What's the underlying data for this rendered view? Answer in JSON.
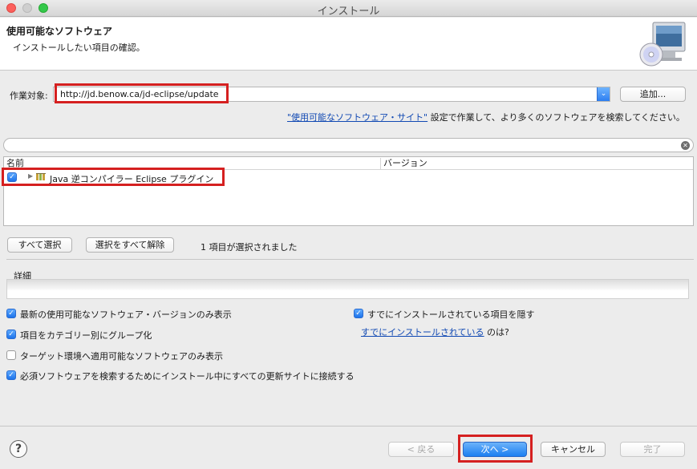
{
  "window": {
    "title": "インストール"
  },
  "header": {
    "title": "使用可能なソフトウェア",
    "subtitle": "インストールしたい項目の確認。",
    "icon": "cd-monitor-icon"
  },
  "work_with": {
    "label": "作業対象:",
    "value": "http://jd.benow.ca/jd-eclipse/update",
    "add_button": "追加..."
  },
  "sites_line": {
    "link": "\"使用可能なソフトウェア・サイト\"",
    "text": " 設定で作業して、より多くのソフトウェアを検索してください。"
  },
  "filter": {
    "value": ""
  },
  "table": {
    "columns": [
      "名前",
      "バージョン"
    ],
    "rows": [
      {
        "checked": true,
        "name": "Java 逆コンパイラー Eclipse プラグイン",
        "version": ""
      }
    ]
  },
  "selection": {
    "select_all": "すべて選択",
    "deselect_all": "選択をすべて解除",
    "status": "1 項目が選択されました"
  },
  "details": {
    "label": "詳細"
  },
  "options": {
    "latest_only": {
      "checked": true,
      "label": "最新の使用可能なソフトウェア・バージョンのみ表示"
    },
    "group_by_category": {
      "checked": true,
      "label": "項目をカテゴリー別にグループ化"
    },
    "target_env_only": {
      "checked": false,
      "label": "ターゲット環境へ適用可能なソフトウェアのみ表示"
    },
    "contact_all_sites": {
      "checked": true,
      "label": "必須ソフトウェアを検索するためにインストール中にすべての更新サイトに接続する"
    },
    "hide_installed": {
      "checked": true,
      "label": "すでにインストールされている項目を隠す"
    },
    "installed_link": "すでにインストールされている",
    "installed_suffix": " のは?"
  },
  "footer": {
    "back": "< 戻る",
    "next": "次へ >",
    "cancel": "キャンセル",
    "finish": "完了"
  }
}
